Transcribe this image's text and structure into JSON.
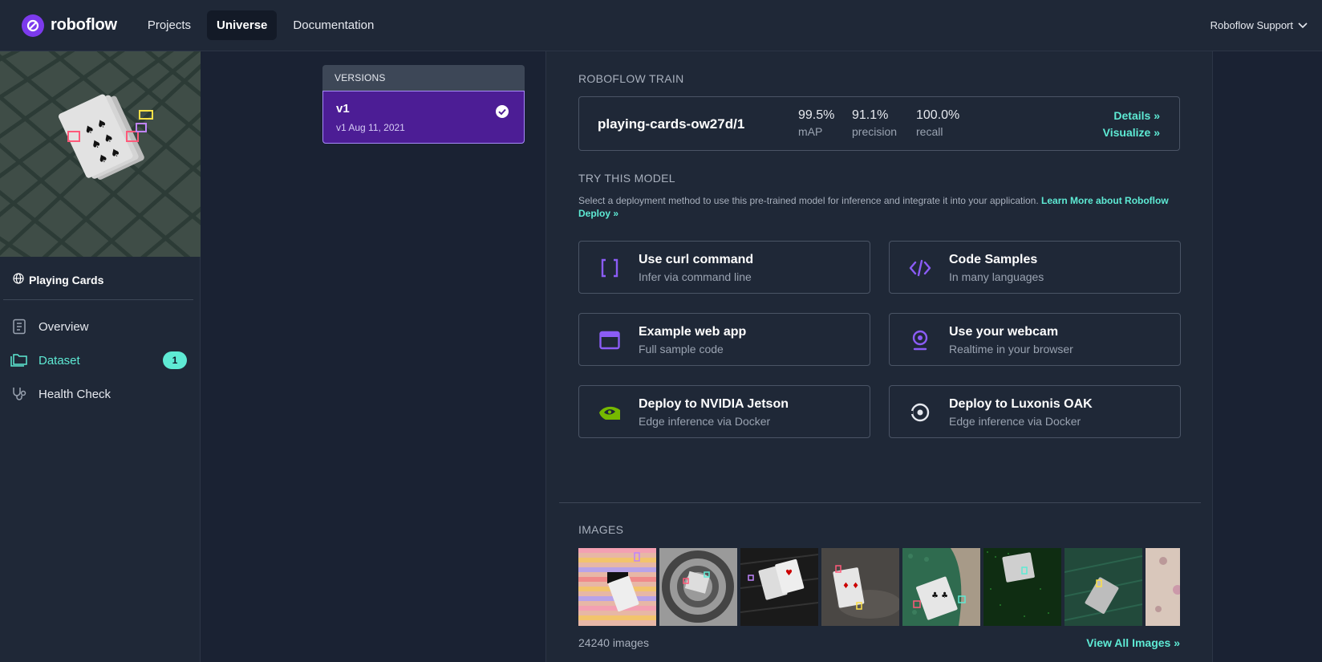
{
  "brand": {
    "name": "roboflow",
    "accent": "#7c3aed",
    "link_color": "#5eead4"
  },
  "nav": {
    "links": [
      {
        "label": "Projects"
      },
      {
        "label": "Universe",
        "active": true
      },
      {
        "label": "Documentation"
      }
    ],
    "account": "Roboflow Support"
  },
  "sidebar": {
    "project": "Playing Cards",
    "items": [
      {
        "label": "Overview",
        "icon": "book-icon"
      },
      {
        "label": "Dataset",
        "icon": "folders-icon",
        "badge": "1",
        "active": true
      },
      {
        "label": "Health Check",
        "icon": "stethoscope-icon"
      }
    ]
  },
  "versions": {
    "header": "VERSIONS",
    "items": [
      {
        "name": "v1",
        "date": "v1 Aug 11, 2021",
        "selected": true
      }
    ]
  },
  "train": {
    "label": "ROBOFLOW TRAIN",
    "model": "playing-cards-ow27d/1",
    "metrics": [
      {
        "value": "99.5%",
        "label": "mAP"
      },
      {
        "value": "91.1%",
        "label": "precision"
      },
      {
        "value": "100.0%",
        "label": "recall"
      }
    ],
    "details_link": "Details »",
    "visualize_link": "Visualize »"
  },
  "try": {
    "label": "TRY THIS MODEL",
    "description": "Select a deployment method to use this pre-trained model for inference and integrate it into your application.",
    "learn_more": "Learn More about Roboflow Deploy »",
    "options": [
      {
        "title": "Use curl command",
        "subtitle": "Infer via command line",
        "icon": "brackets-icon"
      },
      {
        "title": "Code Samples",
        "subtitle": "In many languages",
        "icon": "code-icon"
      },
      {
        "title": "Example web app",
        "subtitle": "Full sample code",
        "icon": "browser-window-icon"
      },
      {
        "title": "Use your webcam",
        "subtitle": "Realtime in your browser",
        "icon": "webcam-icon"
      },
      {
        "title": "Deploy to NVIDIA Jetson",
        "subtitle": "Edge inference via Docker",
        "icon": "nvidia-icon"
      },
      {
        "title": "Deploy to Luxonis OAK",
        "subtitle": "Edge inference via Docker",
        "icon": "luxonis-oak-icon"
      }
    ]
  },
  "images": {
    "label": "IMAGES",
    "count": "24240 images",
    "view_all": "View All Images »"
  }
}
